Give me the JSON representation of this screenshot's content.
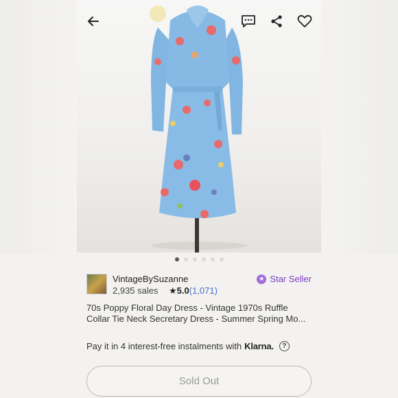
{
  "header": {
    "back_icon": "arrow-left-icon",
    "message_icon": "message-icon",
    "share_icon": "share-icon",
    "favorite_icon": "heart-icon"
  },
  "gallery": {
    "image_count": 6,
    "active_index": 0
  },
  "shop": {
    "name": "VintageBySuzanne",
    "sales": "2,935 sales",
    "rating_star": "★",
    "rating_score": "5.0",
    "rating_count": "(1,071)",
    "badge_label": "Star Seller"
  },
  "listing": {
    "title_line1": "70s Poppy Floral Day Dress - Vintage 1970s Ruffle",
    "title_line2": "Collar Tie Neck Secretary Dress - Summer Spring Mo..."
  },
  "payment": {
    "text": "Pay it in 4 interest-free instalments with",
    "brand": "Klarna.",
    "help_icon": "question-circle-icon"
  },
  "actions": {
    "sold_out_label": "Sold Out"
  },
  "colors": {
    "accent_purple": "#7a3fc2",
    "link_blue": "#4a6fc7",
    "dress_blue": "#7fb4e0"
  }
}
